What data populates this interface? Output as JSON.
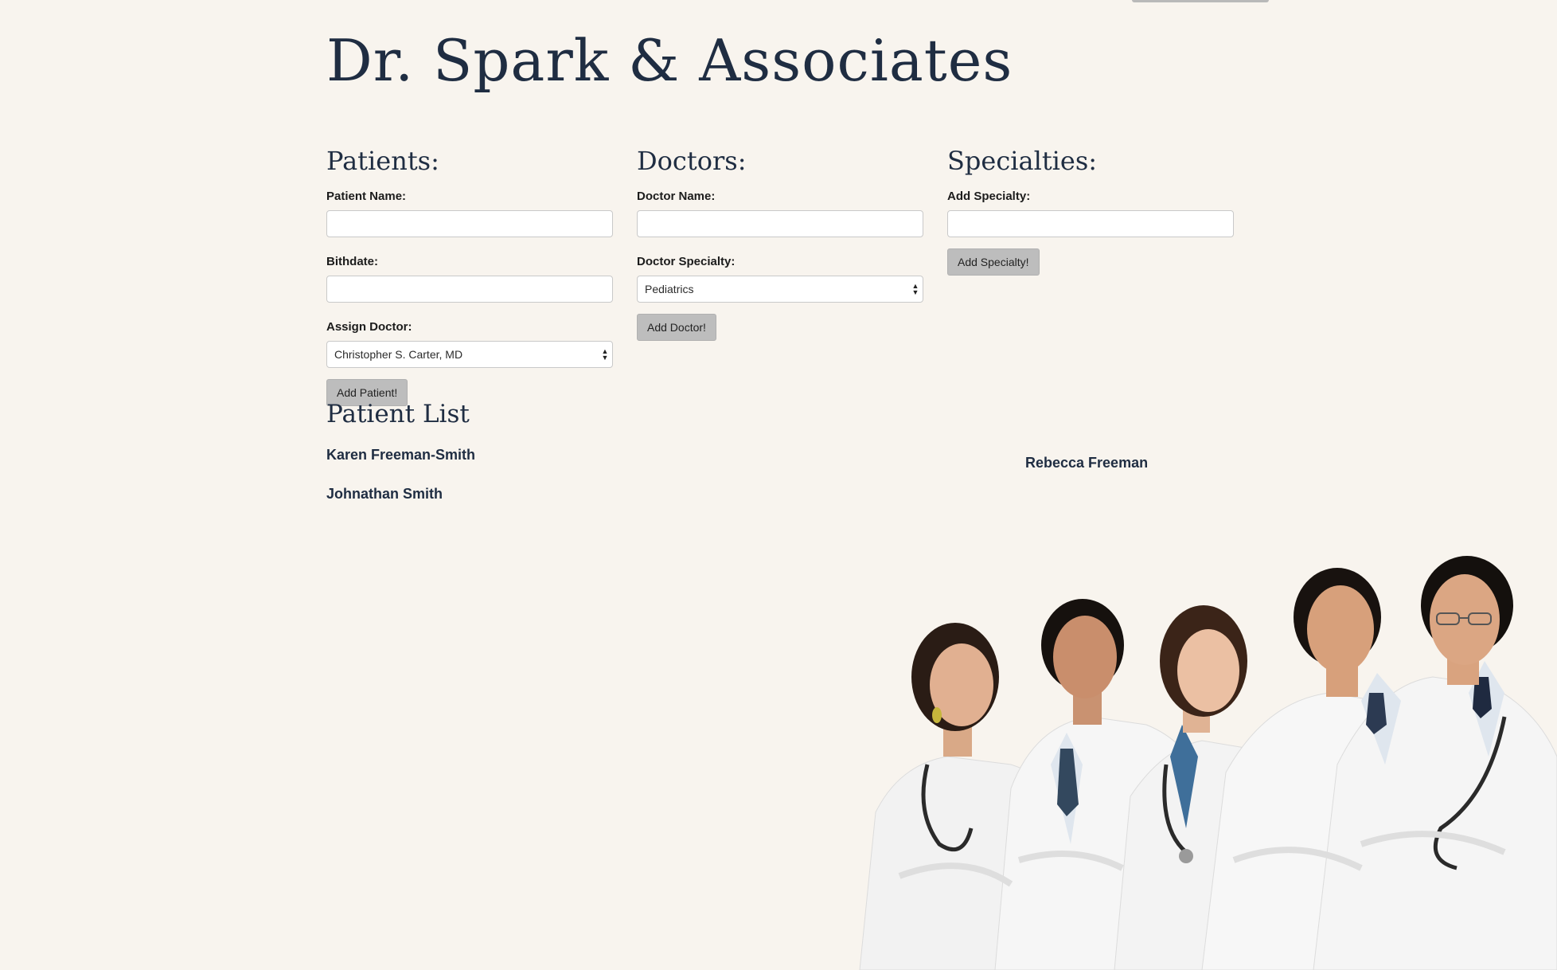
{
  "header": {
    "title": "Dr. Spark & Associates"
  },
  "patients": {
    "heading": "Patients:",
    "name_label": "Patient Name:",
    "name_value": "",
    "birthdate_label": "Bithdate:",
    "birthdate_value": "",
    "doctor_label": "Assign Doctor:",
    "doctor_selected": "Christopher S. Carter, MD",
    "submit_label": "Add Patient!"
  },
  "doctors": {
    "heading": "Doctors:",
    "name_label": "Doctor Name:",
    "name_value": "",
    "specialty_label": "Doctor Specialty:",
    "specialty_selected": "Pediatrics",
    "submit_label": "Add Doctor!"
  },
  "specialties": {
    "heading": "Specialties:",
    "add_label": "Add Specialty:",
    "add_value": "",
    "submit_label": "Add Specialty!"
  },
  "patient_list": {
    "heading": "Patient List",
    "items": [
      "Karen Freeman-Smith",
      "Johnathan Smith"
    ]
  },
  "floating_patient": "Rebecca Freeman",
  "colors": {
    "background": "#f8f4ee",
    "heading_text": "#1f2d42",
    "button_bg": "#bdbdbd",
    "coat_white": "#f4f4f4"
  },
  "image": {
    "subject": "group-of-five-doctors-in-white-coats"
  }
}
